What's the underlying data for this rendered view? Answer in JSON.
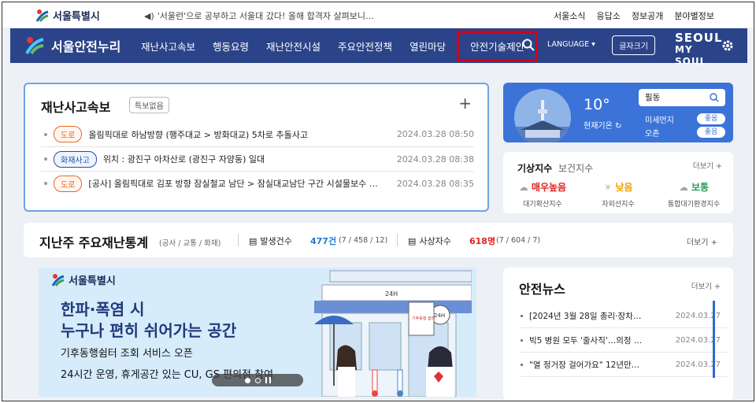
{
  "util": {
    "logo_text": "서울특별시",
    "notice": "'서울런'으로 공부하고 서울대 갔다! 올해 합격자 살펴보니…",
    "links": [
      "서울소식",
      "응답소",
      "정보공개",
      "분야별정보"
    ]
  },
  "nav": {
    "brand": "서울안전누리",
    "menu": [
      "재난사고속보",
      "행동요령",
      "재난안전시설",
      "주요안전정책",
      "열린마당",
      "안전기술제안"
    ],
    "language": "LANGUAGE ▾",
    "fontsize": "글자크기",
    "seoul_line1": "SEOUL",
    "seoul_line2": "MY SOUL"
  },
  "disaster": {
    "title": "재난사고속보",
    "badge": "특보없음",
    "rows": [
      {
        "tag": "도로",
        "text": "올림픽대로 하남방향 (행주대교 > 방화대교) 5차로 추돌사고",
        "time": "2024.03.28 08:50"
      },
      {
        "tag": "화재사고",
        "text": "위치 : 광진구 아차산로 (광진구 자양동) 일대",
        "time": "2024.03.28 08:38"
      },
      {
        "tag": "도로",
        "text": "[공사] 올림픽대로 김포 방향 잠실철교 남단 > 잠실대교남단 구간 시설물보수 ★ …",
        "time": "2024.03.28 08:35"
      }
    ]
  },
  "weather": {
    "temp": "10°",
    "temp_label": "현재기온",
    "location": "필동",
    "dust_label": "미세먼지",
    "dust_value": "좋음",
    "ozone_label": "오존",
    "ozone_value": "좋음"
  },
  "indices": {
    "tab_active": "기상지수",
    "tab_inactive": "보건지수",
    "more": "더보기 +",
    "items": [
      {
        "value": "매우높음",
        "name": "대기확산지수",
        "color": "#e02020"
      },
      {
        "value": "낮음",
        "name": "자외선지수",
        "color": "#f0a000"
      },
      {
        "value": "보통",
        "name": "통합대기환경지수",
        "color": "#2a9d5c"
      }
    ]
  },
  "stats": {
    "title": "지난주 주요재난통계",
    "sub": "(공사 / 교통 / 화재)",
    "occ_label": "발생건수",
    "occ_value": "477건",
    "occ_detail": "(7 / 458 / 12)",
    "cas_label": "사상자수",
    "cas_value": "618명",
    "cas_detail": "(7 / 604 / 7)",
    "more": "더보기 +"
  },
  "banner": {
    "logo_text": "서울특별시",
    "headline1": "한파·폭염 시",
    "headline2": "누구나 편히 쉬어가는 공간",
    "sub1": "기후동행쉼터 조회 서비스 오픈",
    "sub2": "24시간 운영, 휴게공간 있는 CU, GS 편의점 참여",
    "store_sign": "24H",
    "store_sign2": "24H",
    "poster": "기후동행 쉼터"
  },
  "news": {
    "title": "안전뉴스",
    "more": "더보기 +",
    "items": [
      {
        "title": "[2024년 3월 28일 총리·장차…",
        "date": "2024.03.27"
      },
      {
        "title": "빅5 병원 모두 '줄사직'…의정 …",
        "date": "2024.03.27"
      },
      {
        "title": "\"열 정거장 걸어가요\" 12년만…",
        "date": "2024.03.27"
      }
    ]
  },
  "colors": {
    "nav_bg": "#2b4489",
    "highlight_border": "#d0021b",
    "occ_value": "#1e7bd6",
    "cas_value": "#e02020"
  }
}
